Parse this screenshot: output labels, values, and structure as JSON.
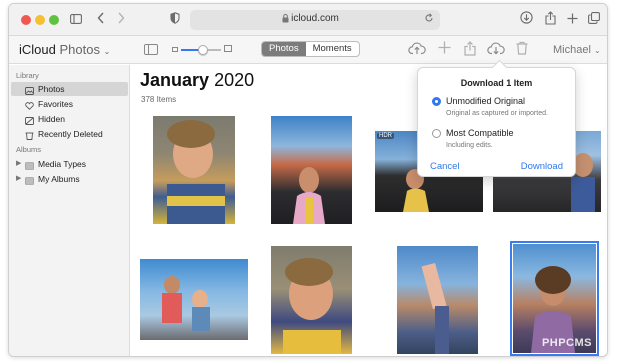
{
  "browser": {
    "url": "icloud.com",
    "icons": [
      "sidebar-icon",
      "back-icon",
      "forward-icon",
      "shield-icon",
      "lock-icon",
      "reload-icon",
      "download-icon",
      "share-icon",
      "new-tab-icon",
      "tabs-icon"
    ]
  },
  "app": {
    "title": "iCloud",
    "subtitle": "Photos",
    "view_tabs": [
      {
        "label": "Photos",
        "active": true
      },
      {
        "label": "Moments",
        "active": false
      }
    ],
    "zoom_level": 0.55,
    "user": "Michael"
  },
  "sidebar": {
    "library_heading": "Library",
    "albums_heading": "Albums",
    "library_items": [
      {
        "label": "Photos",
        "selected": true,
        "icon": "photos-icon"
      },
      {
        "label": "Favorites",
        "selected": false,
        "icon": "heart-icon"
      },
      {
        "label": "Hidden",
        "selected": false,
        "icon": "hidden-icon"
      },
      {
        "label": "Recently Deleted",
        "selected": false,
        "icon": "trash-icon"
      }
    ],
    "album_items": [
      {
        "label": "Media Types",
        "icon": "folder-icon"
      },
      {
        "label": "My Albums",
        "icon": "folder-icon"
      }
    ]
  },
  "main": {
    "month": "January",
    "year": "2020",
    "count": "378 Items",
    "hdr_badge": "HDR",
    "watermark": "PHPCMS"
  },
  "popover": {
    "title": "Download 1 Item",
    "options": [
      {
        "label": "Unmodified Original",
        "desc": "Original as captured or imported.",
        "selected": true
      },
      {
        "label": "Most Compatible",
        "desc": "Including edits.",
        "selected": false
      }
    ],
    "cancel": "Cancel",
    "download": "Download"
  },
  "colors": {
    "accent": "#2f79ec",
    "selection": "#d5d5d5"
  }
}
